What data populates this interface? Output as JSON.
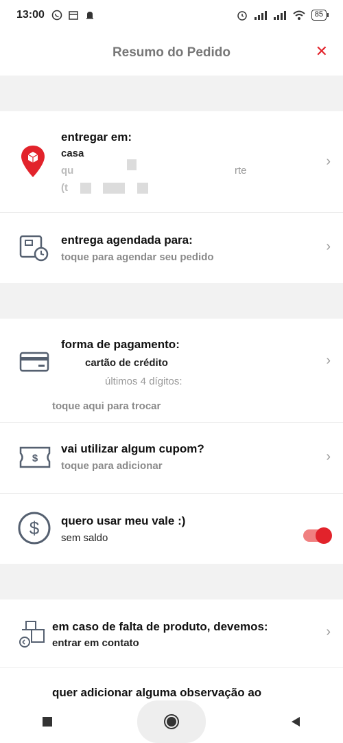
{
  "status": {
    "time": "13:00",
    "battery": "85"
  },
  "header": {
    "title": "Resumo do Pedido",
    "close_icon": "close-icon"
  },
  "delivery": {
    "heading": "entregar em:",
    "name": "casa",
    "line1_start": "qu",
    "line1_end": "rte",
    "line2_start": "(t"
  },
  "schedule": {
    "heading": "entrega agendada para:",
    "sub": "toque para agendar seu pedido"
  },
  "payment": {
    "heading": "forma de pagamento:",
    "method": "cartão de crédito",
    "digits": "últimos 4 dígitos:",
    "change": "toque aqui para trocar"
  },
  "coupon": {
    "heading": "vai utilizar algum cupom?",
    "sub": "toque para adicionar"
  },
  "voucher": {
    "heading": "quero usar meu vale :)",
    "sub": "sem saldo",
    "toggle_on": true
  },
  "shortage": {
    "heading": "em caso de falta de produto, devemos:",
    "sub": "entrar em contato"
  },
  "observation": {
    "heading": "quer adicionar alguma observação ao"
  },
  "colors": {
    "accent": "#e2232b"
  }
}
